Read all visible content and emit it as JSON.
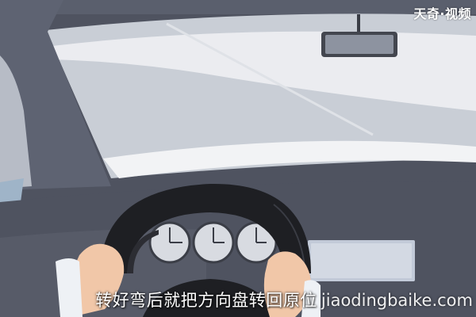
{
  "brand_text": "天奇·视频",
  "subtitle_text": "转好弯后就把方向盘转回原位",
  "watermark_text": "jiaodingbaike.com",
  "colors": {
    "dashboard": "#4f5360",
    "frame": "#5e6372",
    "window": "#c9ced6",
    "streak": "#f2f3f5",
    "wheel": "#1e1f23",
    "gauge_face": "#d8dbe1",
    "hand": "#f1c7a8",
    "cuff": "#eef1f5",
    "screen": "#c2cad8"
  },
  "icons": {
    "mirror": "rearview-mirror-icon",
    "steering": "steering-wheel-icon",
    "gauges": "speedometer-gauge-icon"
  }
}
